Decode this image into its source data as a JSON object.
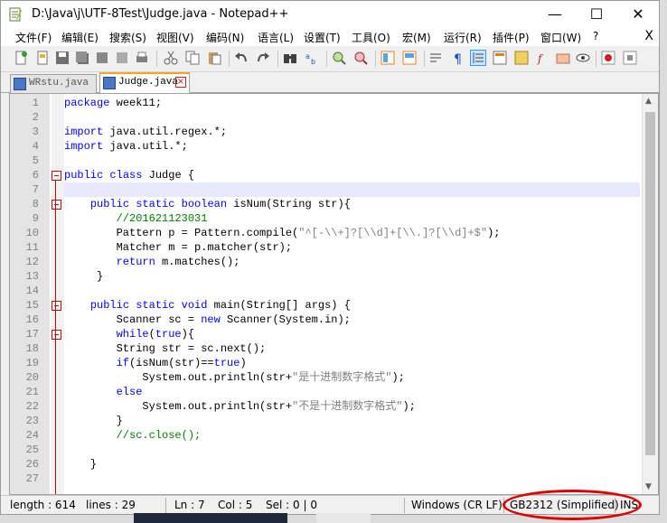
{
  "window": {
    "title": "D:\\Java\\j\\UTF-8Test\\Judge.java - Notepad++",
    "minimize": "—",
    "maximize": "☐",
    "close": "✕"
  },
  "menu": {
    "items": [
      "文件(F)",
      "编辑(E)",
      "搜索(S)",
      "视图(V)",
      "编码(N)",
      "语言(L)",
      "设置(T)",
      "工具(O)",
      "宏(M)",
      "运行(R)",
      "插件(P)",
      "窗口(W)",
      "?"
    ],
    "close": "X"
  },
  "tabs": [
    {
      "label": "WRstu.java",
      "active": false
    },
    {
      "label": "Judge.java",
      "active": true
    }
  ],
  "editor": {
    "current_line": 7,
    "lines": [
      {
        "n": "1",
        "code": "package week11;"
      },
      {
        "n": "2",
        "code": ""
      },
      {
        "n": "3",
        "code": "import java.util.regex.*;"
      },
      {
        "n": "4",
        "code": "import java.util.*;"
      },
      {
        "n": "5",
        "code": ""
      },
      {
        "n": "6",
        "code": "public class Judge {"
      },
      {
        "n": "7",
        "code": ""
      },
      {
        "n": "8",
        "code": "    public static boolean isNum(String str){"
      },
      {
        "n": "9",
        "code": "        //201621123031"
      },
      {
        "n": "10",
        "code": "        Pattern p = Pattern.compile(\"^[-\\\\+]?[\\\\d]+[\\\\.]?[\\\\d]+$\");"
      },
      {
        "n": "11",
        "code": "        Matcher m = p.matcher(str);"
      },
      {
        "n": "12",
        "code": "        return m.matches();"
      },
      {
        "n": "13",
        "code": "     }"
      },
      {
        "n": "14",
        "code": ""
      },
      {
        "n": "15",
        "code": "    public static void main(String[] args) {"
      },
      {
        "n": "16",
        "code": "        Scanner sc = new Scanner(System.in);"
      },
      {
        "n": "17",
        "code": "        while(true){"
      },
      {
        "n": "18",
        "code": "        String str = sc.next();"
      },
      {
        "n": "19",
        "code": "        if(isNum(str)==true)"
      },
      {
        "n": "20",
        "code": "            System.out.println(str+\"是十进制数字格式\");"
      },
      {
        "n": "21",
        "code": "        else"
      },
      {
        "n": "22",
        "code": "            System.out.println(str+\"不是十进制数字格式\");"
      },
      {
        "n": "23",
        "code": "        }"
      },
      {
        "n": "24",
        "code": "        //sc.close();"
      },
      {
        "n": "25",
        "code": ""
      },
      {
        "n": "26",
        "code": "    }"
      },
      {
        "n": "27",
        "code": ""
      }
    ]
  },
  "status": {
    "length": "length : 614",
    "lines": "lines : 29",
    "ln": "Ln : 7",
    "col": "Col : 5",
    "sel": "Sel : 0 | 0",
    "eol": "Windows (CR LF)",
    "encoding": "GB2312 (Simplified)",
    "mode": "INS"
  },
  "colors": {
    "annotation": "#e00000",
    "tab_accent": "#f5a623",
    "keyword": "#0000ff",
    "comment": "#008000"
  }
}
